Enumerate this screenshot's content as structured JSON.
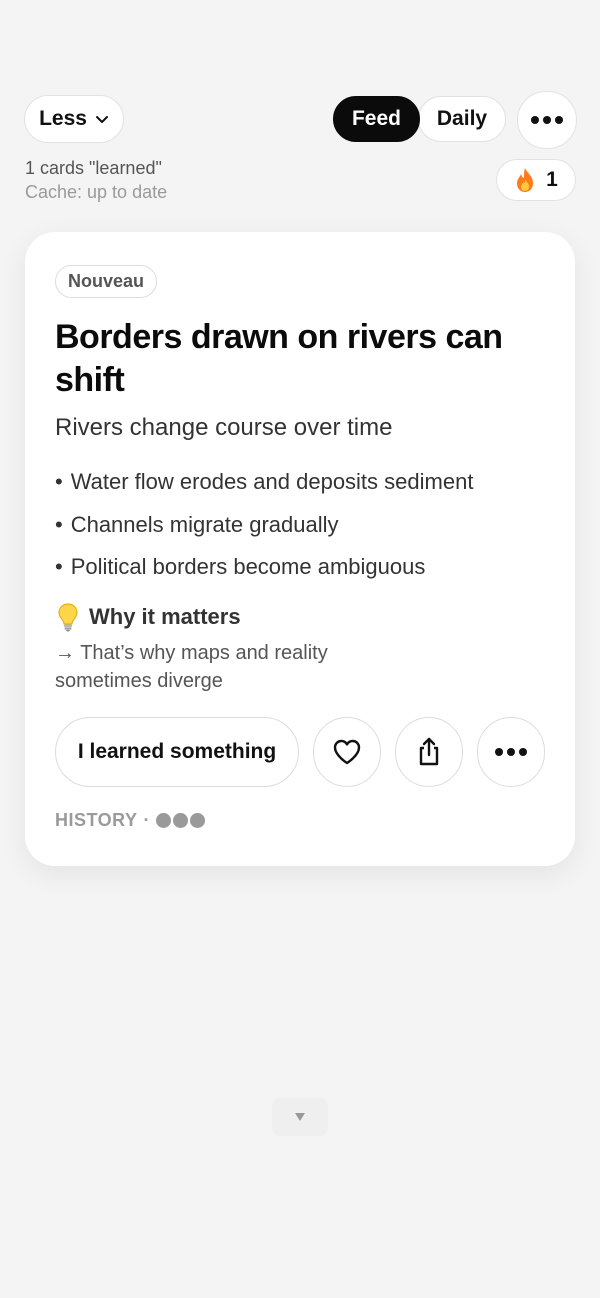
{
  "topbar": {
    "less_label": "Less",
    "feed_label": "Feed",
    "daily_label": "Daily",
    "active_tab": "Feed",
    "more_icon": "ellipsis-icon"
  },
  "stats": {
    "learned_count": "1 cards \"learned\"",
    "cache_status": "Cache: up to date",
    "streak_icon": "flame-icon",
    "streak_count": "1"
  },
  "card": {
    "badge": "Nouveau",
    "title": "Borders drawn on rivers can shift",
    "subtitle": "Rivers change course over time",
    "bullets": [
      "Water flow erodes and deposits sediment",
      "Channels migrate gradually",
      "Political borders become ambiguous"
    ],
    "bullet_symbol": "•",
    "why_icon": "lightbulb-icon",
    "why_heading": "Why it matters",
    "why_body": "→ That’s why maps and reality sometimes diverge",
    "actions": {
      "learned_label": "I learned something",
      "like_icon": "heart-icon",
      "share_icon": "share-icon",
      "more_icon": "ellipsis-icon"
    },
    "category": "HISTORY",
    "category_separator": "·",
    "level_dots": 3
  },
  "colors": {
    "background": "#f4f4f4",
    "card": "#ffffff",
    "active_tab": "#0b0b0b",
    "muted_text": "#9a9a9a"
  },
  "scroll_icon": "chevron-down-icon"
}
